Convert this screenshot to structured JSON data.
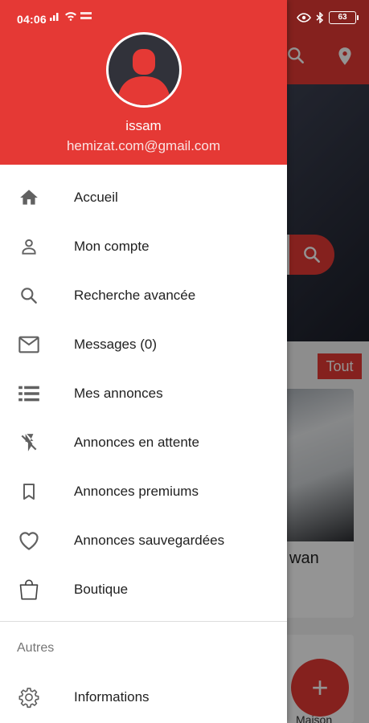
{
  "status_bar": {
    "time": "04:06",
    "battery": "63"
  },
  "drawer": {
    "user": {
      "name": "issam",
      "email": "hemizat.com@gmail.com"
    },
    "menu": [
      {
        "label": "Accueil",
        "icon": "home-icon"
      },
      {
        "label": "Mon compte",
        "icon": "person-icon"
      },
      {
        "label": "Recherche avancée",
        "icon": "search-icon"
      },
      {
        "label": "Messages (0)",
        "icon": "mail-icon"
      },
      {
        "label": "Mes annonces",
        "icon": "list-icon"
      },
      {
        "label": "Annonces en attente",
        "icon": "flash-off-icon"
      },
      {
        "label": "Annonces premiums",
        "icon": "bookmark-icon"
      },
      {
        "label": "Annonces sauvegardées",
        "icon": "heart-icon"
      },
      {
        "label": "Boutique",
        "icon": "shopping-bag-icon"
      }
    ],
    "section_title": "Autres",
    "other_menu": [
      {
        "label": "Informations",
        "icon": "gear-icon"
      }
    ]
  },
  "background": {
    "filter_chip": "Tout",
    "card_title": "wan",
    "card2_title": "Maison",
    "fab": "+"
  },
  "colors": {
    "primary": "#e53935",
    "icon": "#616161",
    "text": "#212121"
  }
}
